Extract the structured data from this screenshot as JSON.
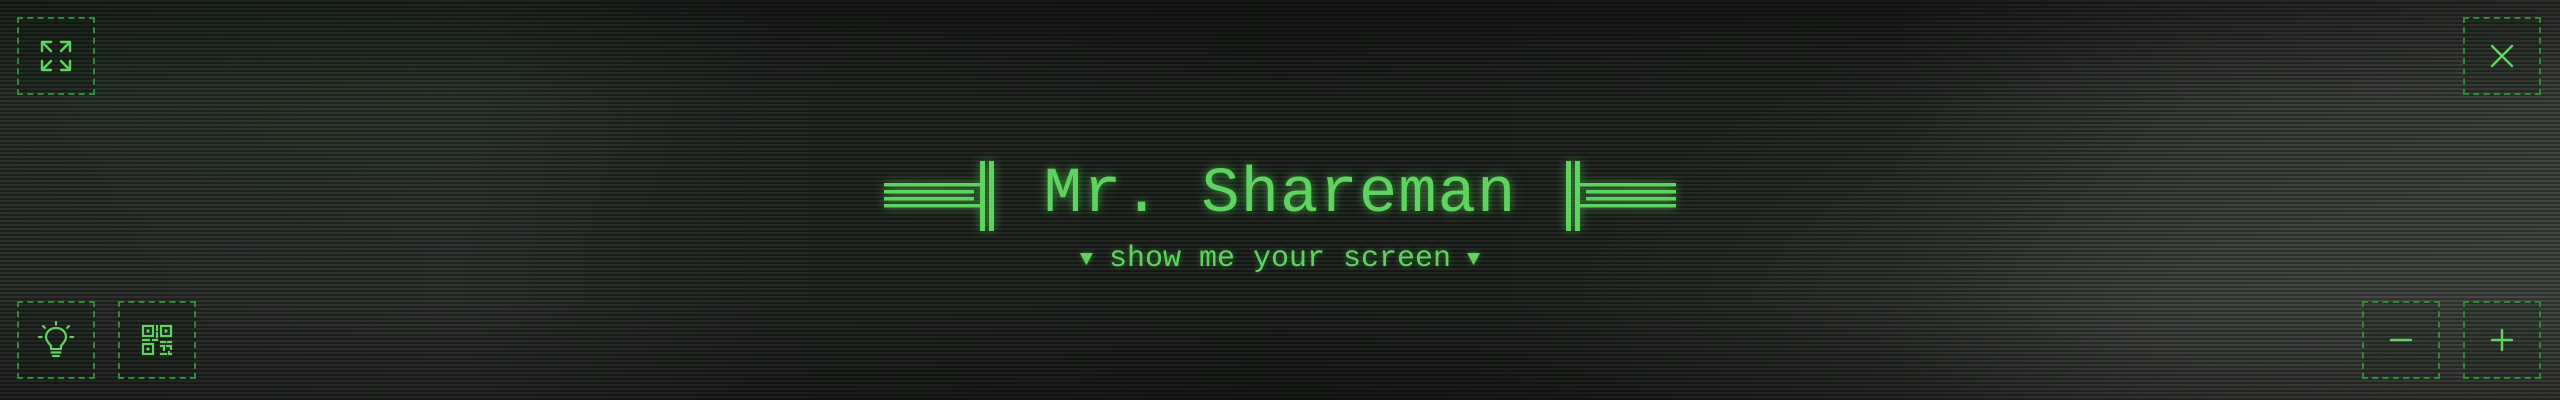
{
  "title": "Mr. Shareman",
  "subtitle": "show me your screen",
  "subtitle_marker": "▼",
  "colors": {
    "accent": "#5fd35f",
    "border": "#2f8a35",
    "background": "#1c1f1c"
  },
  "controls": {
    "fullscreen": {
      "icon": "expand-arrows-icon"
    },
    "close": {
      "icon": "close-icon"
    },
    "hint": {
      "icon": "lightbulb-icon"
    },
    "qr": {
      "icon": "qr-code-icon"
    },
    "zoom_out": {
      "icon": "minus-icon"
    },
    "zoom_in": {
      "icon": "plus-icon"
    }
  }
}
